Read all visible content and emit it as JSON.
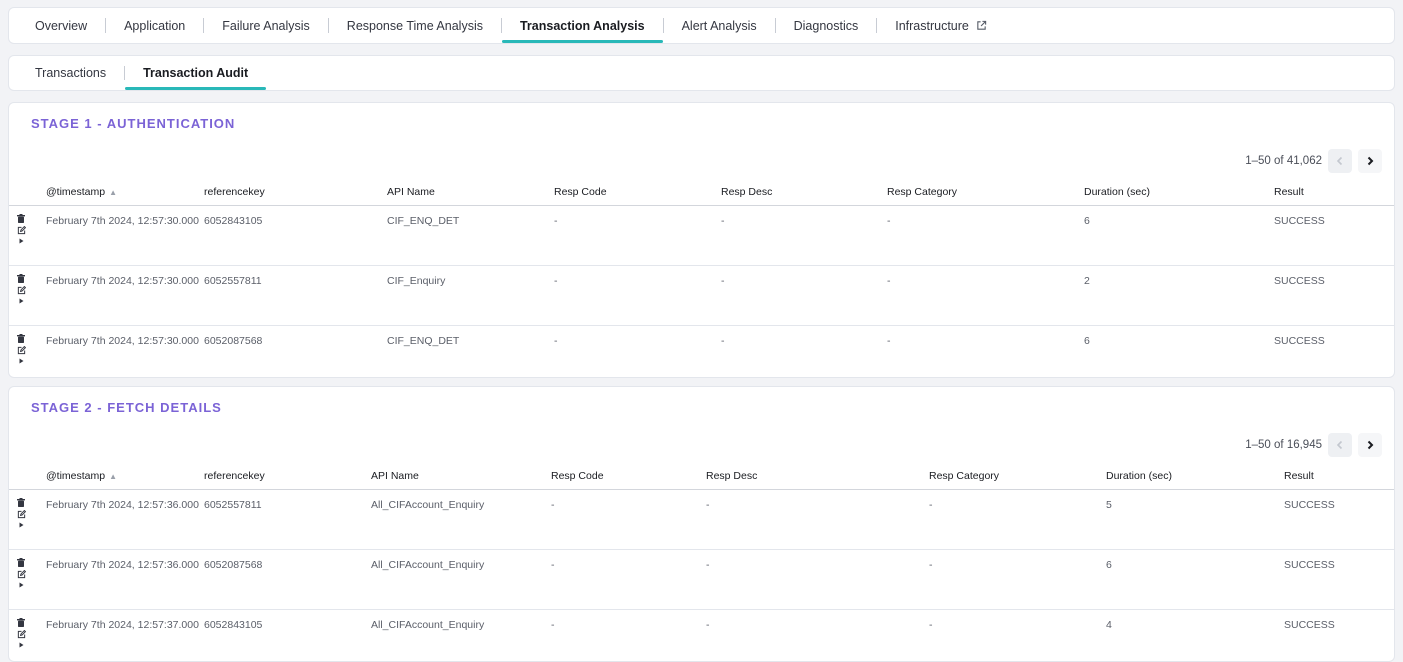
{
  "main_tabs": [
    {
      "label": "Overview",
      "active": false
    },
    {
      "label": "Application",
      "active": false
    },
    {
      "label": "Failure Analysis",
      "active": false
    },
    {
      "label": "Response Time Analysis",
      "active": false
    },
    {
      "label": "Transaction Analysis",
      "active": true
    },
    {
      "label": "Alert Analysis",
      "active": false
    },
    {
      "label": "Diagnostics",
      "active": false
    },
    {
      "label": "Infrastructure",
      "active": false,
      "icon": "external-link-icon"
    }
  ],
  "sub_tabs": [
    {
      "label": "Transactions",
      "active": false
    },
    {
      "label": "Transaction Audit",
      "active": true
    }
  ],
  "colors": {
    "accent_underline": "#29b8b8",
    "panel_title": "#7b63d6"
  },
  "stages": [
    {
      "title": "STAGE 1 - AUTHENTICATION",
      "pagination": "1–50 of 41,062",
      "columns": [
        "@timestamp",
        "referencekey",
        "API Name",
        "Resp Code",
        "Resp Desc",
        "Resp Category",
        "Duration (sec)",
        "Result"
      ],
      "rows": [
        [
          "February 7th 2024, 12:57:30.000",
          "6052843105",
          "CIF_ENQ_DET",
          "-",
          "-",
          "-",
          "6",
          "SUCCESS"
        ],
        [
          "February 7th 2024, 12:57:30.000",
          "6052557811",
          "CIF_Enquiry",
          "-",
          "-",
          "-",
          "2",
          "SUCCESS"
        ],
        [
          "February 7th 2024, 12:57:30.000",
          "6052087568",
          "CIF_ENQ_DET",
          "-",
          "-",
          "-",
          "6",
          "SUCCESS"
        ]
      ]
    },
    {
      "title": "STAGE 2 - FETCH DETAILS",
      "pagination": "1–50 of 16,945",
      "columns": [
        "@timestamp",
        "referencekey",
        "API Name",
        "Resp Code",
        "Resp Desc",
        "Resp Category",
        "Duration (sec)",
        "Result"
      ],
      "rows": [
        [
          "February 7th 2024, 12:57:36.000",
          "6052557811",
          "All_CIFAccount_Enquiry",
          "-",
          "-",
          "-",
          "5",
          "SUCCESS"
        ],
        [
          "February 7th 2024, 12:57:36.000",
          "6052087568",
          "All_CIFAccount_Enquiry",
          "-",
          "-",
          "-",
          "6",
          "SUCCESS"
        ],
        [
          "February 7th 2024, 12:57:37.000",
          "6052843105",
          "All_CIFAccount_Enquiry",
          "-",
          "-",
          "-",
          "4",
          "SUCCESS"
        ]
      ]
    }
  ]
}
